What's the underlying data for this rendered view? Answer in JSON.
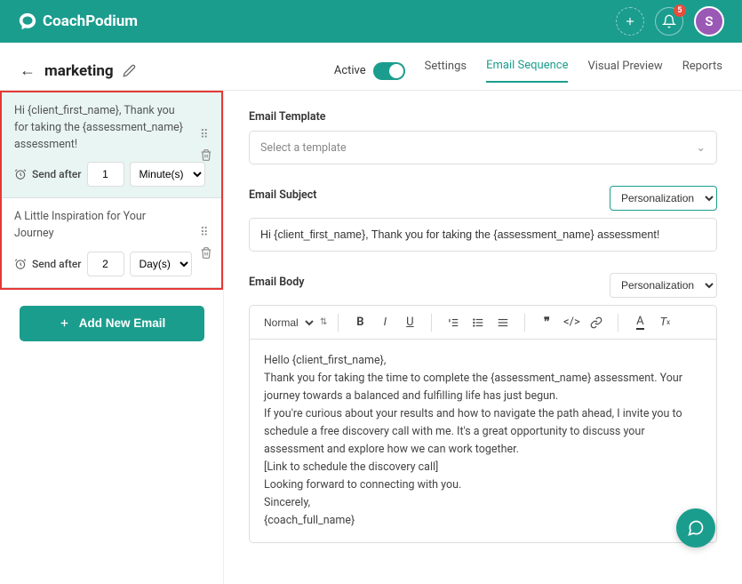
{
  "header": {
    "brand": "CoachPodium",
    "notification_count": "5",
    "avatar_initial": "S"
  },
  "subheader": {
    "title": "marketing",
    "active_label": "Active",
    "tabs": [
      "Settings",
      "Email Sequence",
      "Visual Preview",
      "Reports"
    ],
    "active_tab_index": 1
  },
  "sidebar": {
    "emails": [
      {
        "title": "Hi {client_first_name}, Thank you for taking the {assessment_name} assessment!",
        "send_after_label": "Send after",
        "delay_value": "1",
        "delay_unit": "Minute(s)",
        "selected": true
      },
      {
        "title": "A Little Inspiration for Your Journey",
        "send_after_label": "Send after",
        "delay_value": "2",
        "delay_unit": "Day(s)",
        "selected": false
      }
    ],
    "add_button": "Add New Email"
  },
  "content": {
    "template_label": "Email Template",
    "template_placeholder": "Select a template",
    "subject_label": "Email Subject",
    "subject_value": "Hi {client_first_name}, Thank you for taking the {assessment_name} assessment!",
    "personalization_label": "Personalization",
    "body_label": "Email Body",
    "editor": {
      "format": "Normal",
      "body_text": "Hello {client_first_name},\nThank you for taking the time to complete the {assessment_name} assessment. Your journey towards a balanced and fulfilling life has just begun.\nIf you're curious about your results and how to navigate the path ahead, I invite you to schedule a free discovery call with me. It's a great opportunity to discuss your assessment and explore how we can work together.\n[Link to schedule the discovery call]\nLooking forward to connecting with you.\nSincerely,\n{coach_full_name}"
    }
  }
}
